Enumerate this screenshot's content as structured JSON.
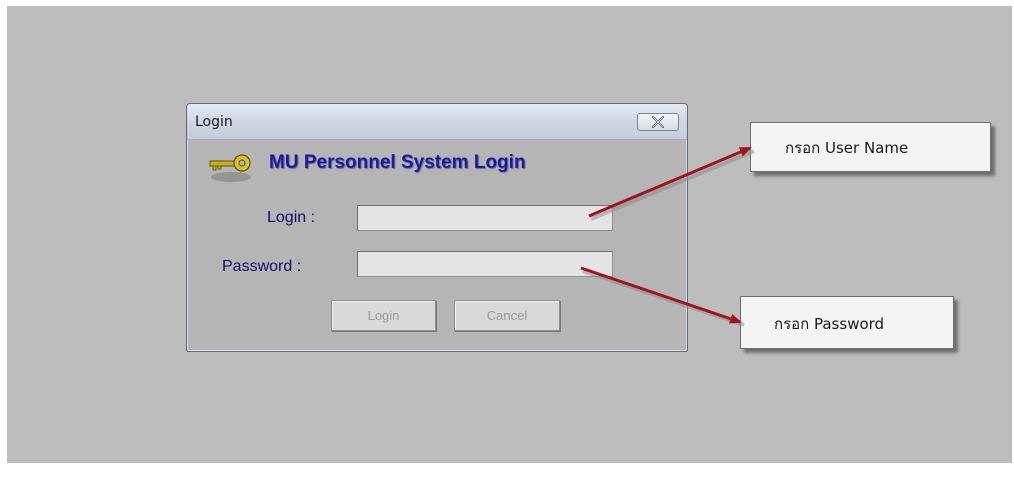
{
  "dialog": {
    "title": "Login",
    "heading": "MU Personnel System Login",
    "login_label": "Login :",
    "password_label": "Password :",
    "login_value": "",
    "password_value": "",
    "login_button": "Login",
    "cancel_button": "Cancel",
    "icons": {
      "header": "key-icon",
      "close": "close-icon"
    }
  },
  "annotations": {
    "username_callout": "กรอก User Name",
    "password_callout": "กรอก Password",
    "arrow_color": "#a0151b"
  },
  "colors": {
    "heading": "#1a1aa0",
    "label": "#0d0d6b",
    "canvas": "#bdbdbd"
  }
}
